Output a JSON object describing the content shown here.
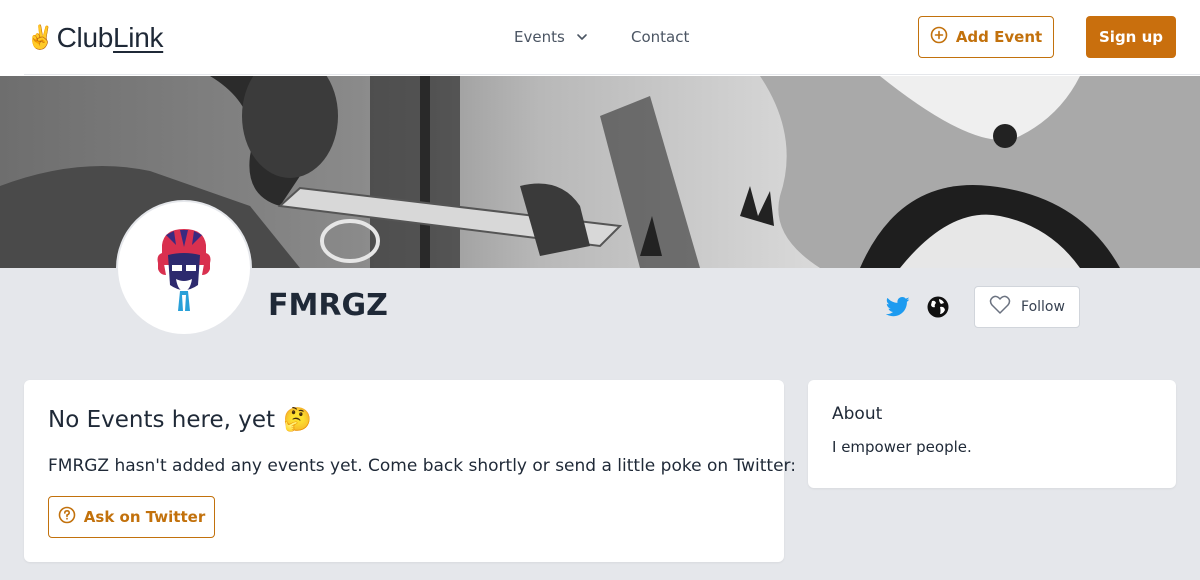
{
  "colors": {
    "accent": "#c96f0d",
    "accent_outline": "#c2710c",
    "twitter": "#1d9bf0",
    "background": "#e5e7eb"
  },
  "header": {
    "logo_club": "Club",
    "logo_link": "Link",
    "logo_emoji": "✌️",
    "nav_events": "Events",
    "nav_contact": "Contact",
    "add_event_label": "Add Event",
    "signup_label": "Sign up"
  },
  "profile": {
    "name": "FMRGZ",
    "follow_label": "Follow",
    "links": [
      "twitter-icon",
      "globe-icon"
    ]
  },
  "events_card": {
    "title": "No Events here, yet",
    "emoji": "🤔",
    "description": "FMRGZ hasn't added any events yet. Come back shortly or send a little poke on Twitter:",
    "ask_button_label": "Ask on Twitter"
  },
  "about_card": {
    "title": "About",
    "text": "I empower people."
  }
}
